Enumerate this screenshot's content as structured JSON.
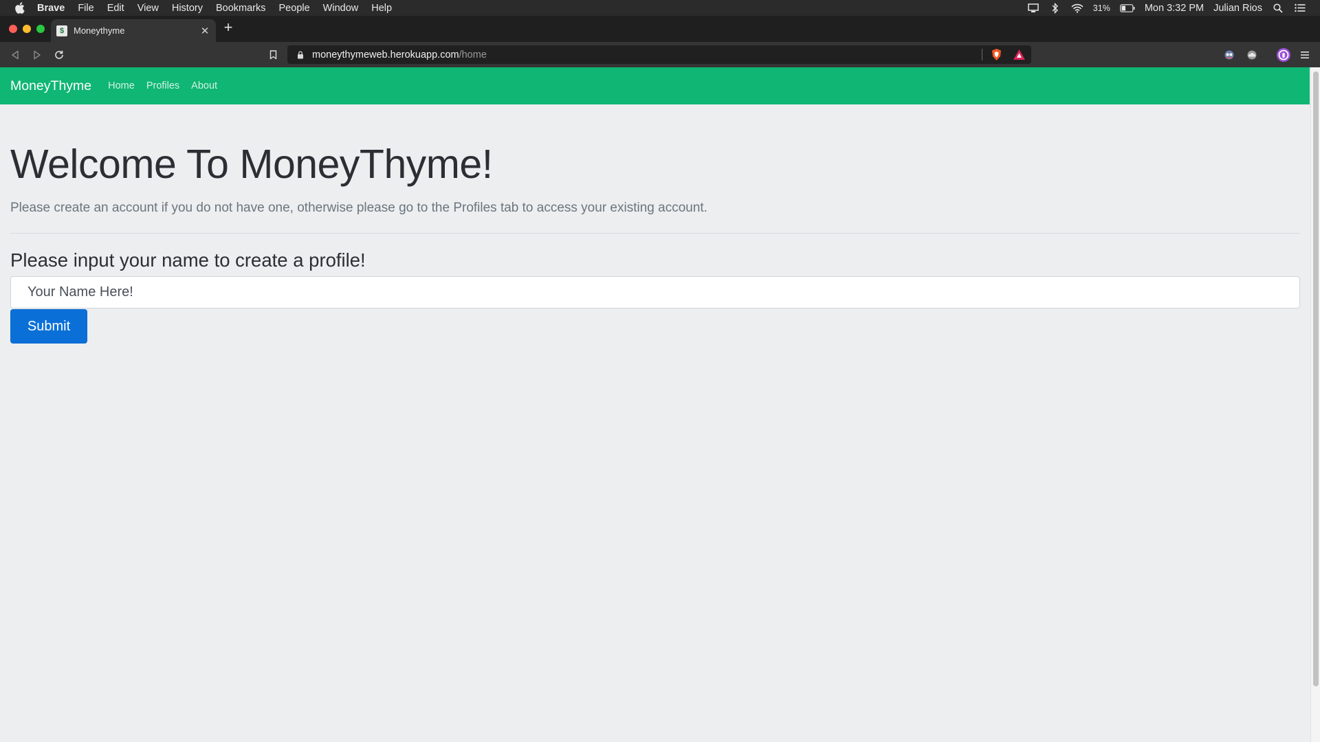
{
  "menubar": {
    "app_name": "Brave",
    "items": [
      "File",
      "Edit",
      "View",
      "History",
      "Bookmarks",
      "People",
      "Window",
      "Help"
    ],
    "battery_percent": "31%",
    "clock": "Mon 3:32 PM",
    "user": "Julian Rios"
  },
  "browser": {
    "tab_title": "Moneythyme",
    "url_host": "moneythymeweb.herokuapp.com",
    "url_path": "/home"
  },
  "site": {
    "brand": "MoneyThyme",
    "nav": [
      "Home",
      "Profiles",
      "About"
    ],
    "heading": "Welcome To MoneyThyme!",
    "lead": "Please create an account if you do not have one, otherwise please go to the Profiles tab to access your existing account.",
    "form_title": "Please input your name to create a profile!",
    "name_placeholder": "Your Name Here!",
    "submit_label": "Submit"
  },
  "colors": {
    "navbar": "#10b673",
    "button": "#0a70d8",
    "page_background": "#eceef0"
  }
}
